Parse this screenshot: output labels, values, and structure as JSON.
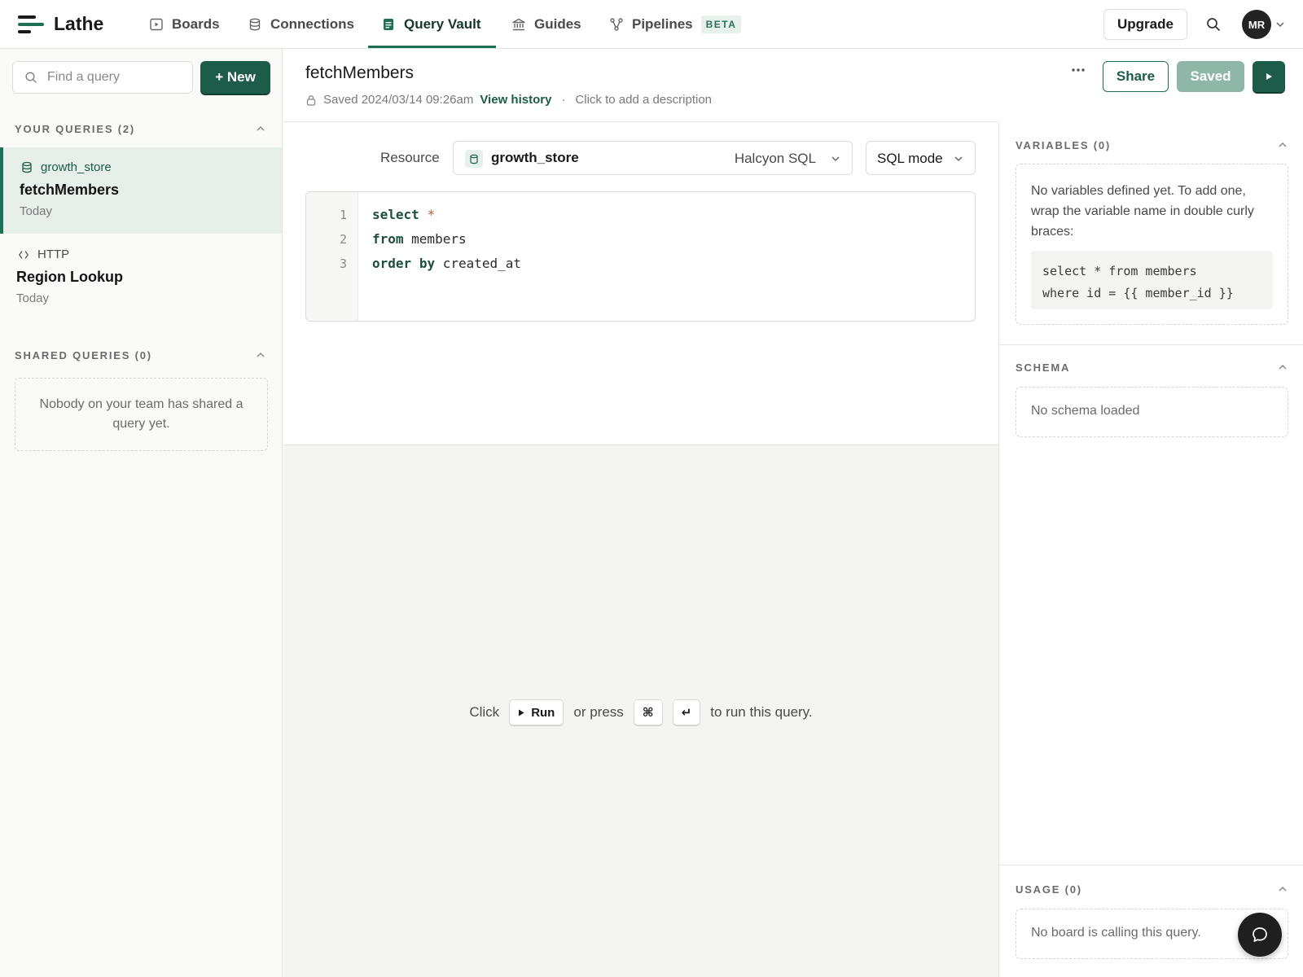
{
  "app": {
    "name": "Lathe"
  },
  "nav": {
    "tabs": [
      {
        "label": "Boards",
        "icon": "play-square-icon"
      },
      {
        "label": "Connections",
        "icon": "database-icon"
      },
      {
        "label": "Query Vault",
        "icon": "document-icon",
        "active": true
      },
      {
        "label": "Guides",
        "icon": "library-icon"
      },
      {
        "label": "Pipelines",
        "icon": "workflow-icon",
        "badge": "BETA"
      }
    ],
    "upgrade_label": "Upgrade",
    "avatar_initials": "MR"
  },
  "sidebar": {
    "search_placeholder": "Find a query",
    "new_label": "+ New",
    "your_queries_heading": "YOUR QUERIES (2)",
    "queries": [
      {
        "source": "growth_store",
        "source_icon": "database-icon",
        "name": "fetchMembers",
        "date": "Today",
        "active": true
      },
      {
        "source": "HTTP",
        "source_icon": "code-brackets-icon",
        "name": "Region Lookup",
        "date": "Today",
        "active": false
      }
    ],
    "shared_heading": "SHARED QUERIES (0)",
    "shared_empty": "Nobody on your team has shared a query yet."
  },
  "query": {
    "title": "fetchMembers",
    "saved_text": "Saved 2024/03/14 09:26am",
    "history_link": "View history",
    "separator": "·",
    "description_placeholder": "Click to add a description",
    "share_label": "Share",
    "saved_label": "Saved"
  },
  "resource": {
    "label": "Resource",
    "name": "growth_store",
    "engine": "Halcyon SQL",
    "mode": "SQL mode"
  },
  "editor": {
    "line_numbers": [
      "1",
      "2",
      "3"
    ],
    "lines": [
      [
        {
          "t": "select",
          "c": "kw"
        },
        {
          "t": " "
        },
        {
          "t": "*",
          "c": "op"
        }
      ],
      [
        {
          "t": "from",
          "c": "kw"
        },
        {
          "t": " members"
        }
      ],
      [
        {
          "t": "order",
          "c": "kw"
        },
        {
          "t": " "
        },
        {
          "t": "by",
          "c": "kw"
        },
        {
          "t": " created_at"
        }
      ]
    ]
  },
  "results": {
    "hint_click": "Click",
    "run_key": "Run",
    "hint_press": "or press",
    "cmd_key": "⌘",
    "enter_key": "↵",
    "hint_tail": "to run this query."
  },
  "right_panel": {
    "variables_heading": "VARIABLES (0)",
    "variables_help": "No variables defined yet. To add one, wrap the variable name in double curly braces:",
    "variables_example": "select * from members\nwhere id = {{ member_id }}",
    "schema_heading": "SCHEMA",
    "schema_empty": "No schema loaded",
    "usage_heading": "USAGE (0)",
    "usage_empty": "No board is calling this query."
  },
  "colors": {
    "brand": "#1d5c49",
    "brand_light": "#e6efea",
    "saved_disabled": "#8fb7a8"
  }
}
